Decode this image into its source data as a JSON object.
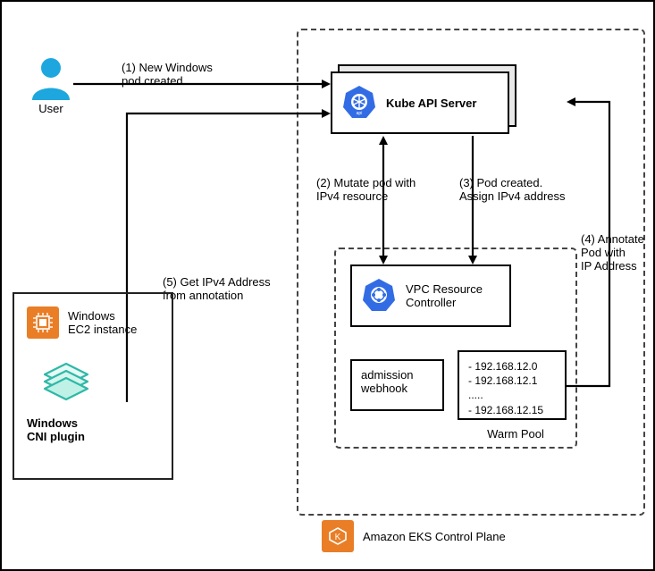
{
  "user_label": "User",
  "step1": "(1) New Windows\npod created",
  "kube_api": "Kube API Server",
  "step2": "(2) Mutate pod with\nIPv4 resource",
  "step3": "(3) Pod created.\nAssign IPv4 address",
  "vpc_controller": "VPC Resource\nController",
  "admission_webhook": "admission\nwebhook",
  "warm_pool_label": "Warm Pool",
  "warm_pool_items": {
    "line1": "- 192.168.12.0",
    "line2": "- 192.168.12.1",
    "line3": ".....",
    "line4": "- 192.168.12.15"
  },
  "step4": "(4) Annotate\nPod with\nIP Address",
  "step5": "(5) Get IPv4 Address\nfrom annotation",
  "ec2_label": "Windows\nEC2 instance",
  "cni_label": "Windows\nCNI plugin",
  "eks_label": "Amazon EKS Control Plane",
  "chart_data": {
    "type": "diagram",
    "title": "Amazon EKS Windows Networking Flow",
    "nodes": [
      {
        "id": "user",
        "label": "User"
      },
      {
        "id": "kube_api",
        "label": "Kube API Server"
      },
      {
        "id": "vpc_rc",
        "label": "VPC Resource Controller"
      },
      {
        "id": "admission_webhook",
        "label": "admission webhook"
      },
      {
        "id": "warm_pool",
        "label": "Warm Pool",
        "items": [
          "192.168.12.0",
          "192.168.12.1",
          "...",
          "192.168.12.15"
        ]
      },
      {
        "id": "windows_ec2",
        "label": "Windows EC2 instance"
      },
      {
        "id": "windows_cni",
        "label": "Windows CNI plugin"
      },
      {
        "id": "eks_control_plane",
        "label": "Amazon EKS Control Plane"
      }
    ],
    "edges": [
      {
        "from": "user",
        "to": "kube_api",
        "label": "(1) New Windows pod created"
      },
      {
        "from": "kube_api",
        "to": "vpc_rc",
        "label": "(2) Mutate pod with IPv4 resource",
        "bidirectional": true
      },
      {
        "from": "kube_api",
        "to": "vpc_rc",
        "label": "(3) Pod created. Assign IPv4 address"
      },
      {
        "from": "warm_pool",
        "to": "kube_api",
        "label": "(4) Annotate Pod with IP Address"
      },
      {
        "from": "windows_cni",
        "to": "kube_api",
        "label": "(5) Get IPv4 Address from annotation"
      }
    ]
  }
}
